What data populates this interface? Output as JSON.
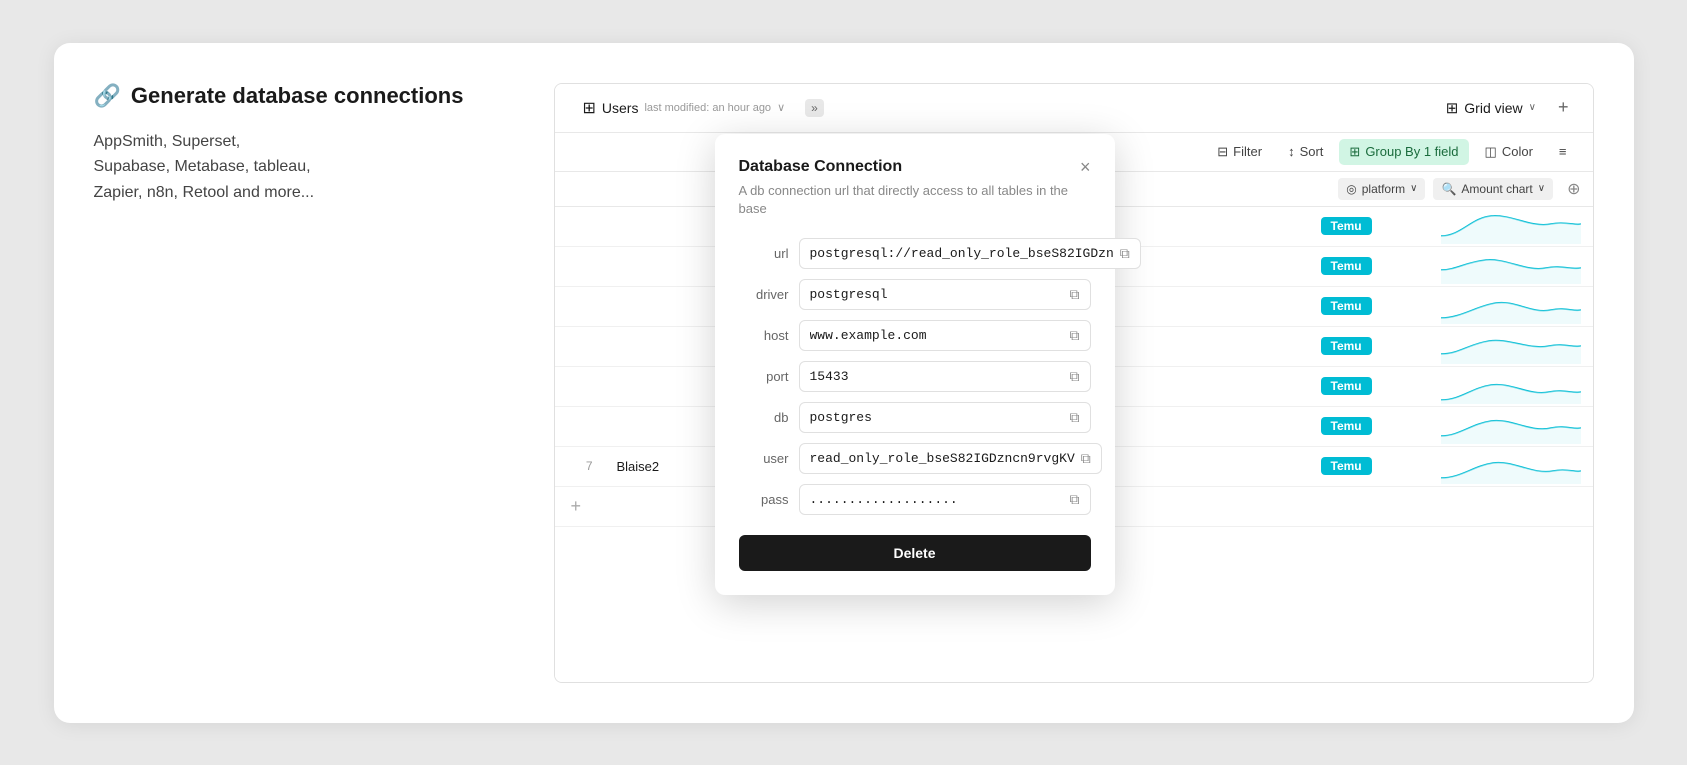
{
  "left": {
    "title": "Generate database connections",
    "description": "AppSmith, Superset,\nSupabase, Metabase, tableau,\nZapier, n8n, Retool and more..."
  },
  "toolbar": {
    "table_name": "Users",
    "last_modified": "last modified: an hour ago",
    "view_label": "Grid view",
    "plus_label": "+"
  },
  "actions": {
    "filter_label": "Filter",
    "sort_label": "Sort",
    "group_label": "Group By 1 field",
    "color_label": "Color"
  },
  "group_bar": {
    "platform_label": "platform",
    "amount_label": "Amount chart"
  },
  "table": {
    "rows": [
      {
        "num": "",
        "name": "",
        "platform": "Temu",
        "has_chart": true
      },
      {
        "num": "",
        "name": "",
        "platform": "Temu",
        "has_chart": true
      },
      {
        "num": "",
        "name": "",
        "platform": "Temu",
        "has_chart": true
      },
      {
        "num": "",
        "name": "",
        "platform": "Temu",
        "has_chart": true
      },
      {
        "num": "",
        "name": "",
        "platform": "Temu",
        "has_chart": true
      },
      {
        "num": "",
        "name": "",
        "platform": "Temu",
        "has_chart": true
      },
      {
        "num": "7",
        "name": "Blaise2",
        "platform": "Temu",
        "has_chart": true
      }
    ]
  },
  "modal": {
    "title": "Database Connection",
    "subtitle": "A db connection url that directly access to all tables in the base",
    "fields": [
      {
        "label": "url",
        "value": "postgresql://read_only_role_bseS82IGDzn",
        "type": "text"
      },
      {
        "label": "driver",
        "value": "postgresql",
        "type": "text"
      },
      {
        "label": "host",
        "value": "www.example.com",
        "type": "text"
      },
      {
        "label": "port",
        "value": "15433",
        "type": "text"
      },
      {
        "label": "db",
        "value": "postgres",
        "type": "text"
      },
      {
        "label": "user",
        "value": "read_only_role_bseS82IGDzncn9rvgKV",
        "type": "text"
      },
      {
        "label": "pass",
        "value": "...................",
        "type": "password"
      }
    ],
    "delete_label": "Delete"
  },
  "icons": {
    "link": "🔗",
    "grid": "⊞",
    "filter": "⊟",
    "sort": "↕",
    "group": "⊞",
    "color": "🎨",
    "copy": "⧉",
    "search": "🔍",
    "stack": "⊕",
    "circle_check": "◎",
    "chevron_down": "∨",
    "close": "×",
    "hamburger": "≡",
    "expand": "»"
  }
}
